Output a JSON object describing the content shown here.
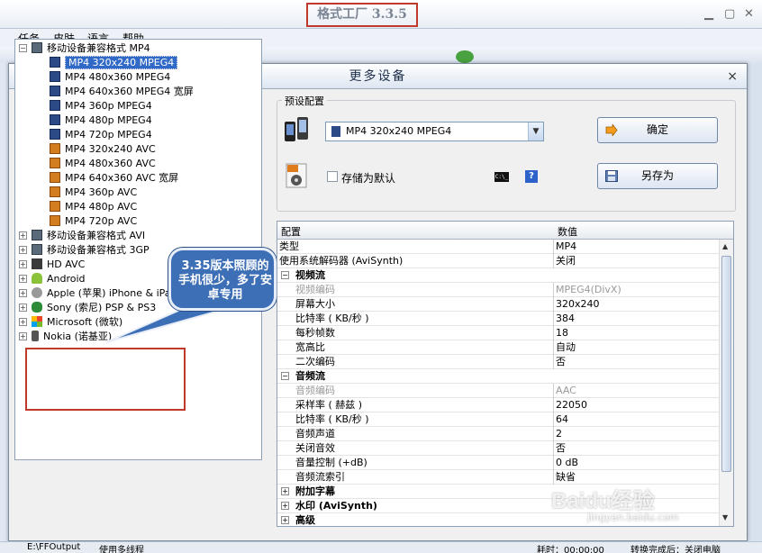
{
  "main_window": {
    "title": "格式工厂 3.3.5",
    "menu": [
      "任务",
      "皮肤",
      "语言",
      "帮助"
    ]
  },
  "dialog": {
    "title": "更多设备",
    "close": "×"
  },
  "tree": {
    "root_label": "移动设备兼容格式 MP4",
    "mp4_items": [
      {
        "label": "MP4 320x240 MPEG4",
        "kind": "mp4",
        "selected": true
      },
      {
        "label": "MP4 480x360 MPEG4",
        "kind": "mp4"
      },
      {
        "label": "MP4 640x360 MPEG4 宽屏",
        "kind": "mp4"
      },
      {
        "label": "MP4 360p MPEG4",
        "kind": "mp4"
      },
      {
        "label": "MP4 480p MPEG4",
        "kind": "mp4"
      },
      {
        "label": "MP4 720p MPEG4",
        "kind": "mp4"
      },
      {
        "label": "MP4 320x240 AVC",
        "kind": "avc"
      },
      {
        "label": "MP4 480x360 AVC",
        "kind": "avc"
      },
      {
        "label": "MP4 640x360 AVC 宽屏",
        "kind": "avc"
      },
      {
        "label": "MP4 360p AVC",
        "kind": "avc"
      },
      {
        "label": "MP4 480p AVC",
        "kind": "avc"
      },
      {
        "label": "MP4 720p AVC",
        "kind": "avc"
      }
    ],
    "groups": [
      {
        "label": "移动设备兼容格式 AVI",
        "icon": "grp"
      },
      {
        "label": "移动设备兼容格式 3GP",
        "icon": "grp"
      },
      {
        "label": "HD AVC",
        "icon": "hd"
      },
      {
        "label": "Android",
        "icon": "android"
      },
      {
        "label": "Apple (苹果) iPhone & iPad",
        "icon": "apple"
      },
      {
        "label": "Sony (索尼) PSP & PS3",
        "icon": "sony"
      },
      {
        "label": "Microsoft (微软)",
        "icon": "ms"
      },
      {
        "label": "Nokia (诺基亚)",
        "icon": "nokia"
      }
    ]
  },
  "annotation": {
    "callout": "3.35版本照顾的手机很少，多了安卓专用"
  },
  "preset": {
    "group_label": "预设配置",
    "combo_value": "MP4 320x240 MPEG4",
    "ok_button": "确定",
    "save_as_button": "另存为",
    "save_default_label": "存储为默认",
    "help": "?",
    "cmd": "C:\\_"
  },
  "props": {
    "header_key": "配置",
    "header_value": "数值",
    "rows": [
      {
        "k": "类型",
        "v": "MP4",
        "type": "plain"
      },
      {
        "k": "使用系统解码器 (AviSynth)",
        "v": "关闭",
        "type": "plain"
      },
      {
        "k": "视频流",
        "v": "",
        "type": "cat"
      },
      {
        "k": "视频编码",
        "v": "MPEG4(DivX)",
        "type": "grey"
      },
      {
        "k": "屏幕大小",
        "v": "320x240",
        "type": "indent"
      },
      {
        "k": "比特率 ( KB/秒 )",
        "v": "384",
        "type": "indent"
      },
      {
        "k": "每秒帧数",
        "v": "18",
        "type": "indent"
      },
      {
        "k": "宽高比",
        "v": "自动",
        "type": "indent"
      },
      {
        "k": "二次编码",
        "v": "否",
        "type": "indent"
      },
      {
        "k": "音频流",
        "v": "",
        "type": "cat"
      },
      {
        "k": "音频编码",
        "v": "AAC",
        "type": "grey"
      },
      {
        "k": "采样率 ( 赫兹 )",
        "v": "22050",
        "type": "indent"
      },
      {
        "k": "比特率 ( KB/秒 )",
        "v": "64",
        "type": "indent"
      },
      {
        "k": "音频声道",
        "v": "2",
        "type": "indent"
      },
      {
        "k": "关闭音效",
        "v": "否",
        "type": "indent"
      },
      {
        "k": "音量控制 (+dB)",
        "v": "0 dB",
        "type": "indent"
      },
      {
        "k": "音频流索引",
        "v": "缺省",
        "type": "indent"
      },
      {
        "k": "附加字幕",
        "v": "",
        "type": "cat"
      },
      {
        "k": "水印 (AviSynth)",
        "v": "",
        "type": "cat"
      },
      {
        "k": "高级",
        "v": "",
        "type": "cat"
      }
    ]
  },
  "status": {
    "left": "E:\\FFOutput",
    "middle": "使用多线程",
    "right": "耗时：00:00:00",
    "right2": "转换完成后：关闭电脑"
  },
  "watermark": {
    "text": "Baidu经验",
    "sub": "jingyan.baidu.com"
  }
}
